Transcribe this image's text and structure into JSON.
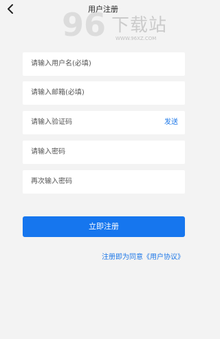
{
  "header": {
    "title": "用户注册"
  },
  "form": {
    "username_placeholder": "请输入用户名(必填)",
    "email_placeholder": "请输入邮箱(必填)",
    "code_placeholder": "请输入验证码",
    "send_label": "发送",
    "password_placeholder": "请输入密码",
    "confirm_placeholder": "再次输入密码"
  },
  "actions": {
    "register_label": "立即注册",
    "agreement_text": "注册即为同意《用户协议》"
  },
  "watermark": {
    "digits": "96",
    "name": "下载站",
    "url": "WWW.96XZ.COM"
  },
  "colors": {
    "accent": "#1676ee",
    "background": "#f3f3f3"
  }
}
